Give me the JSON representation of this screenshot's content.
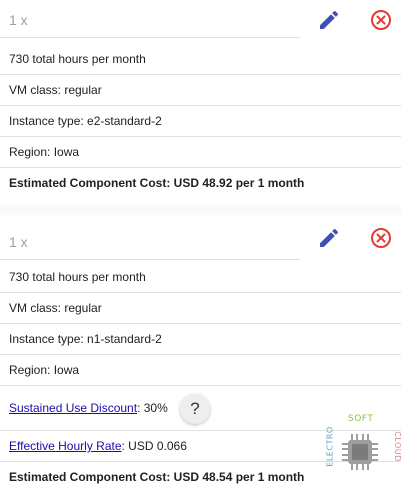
{
  "items": [
    {
      "quantity": "1 x",
      "hours": "730 total hours per month",
      "vm_class": "VM class: regular",
      "instance_type": "Instance type: e2-standard-2",
      "region": "Region: Iowa",
      "estimated_cost": "Estimated Component Cost: USD 48.92 per 1 month"
    },
    {
      "quantity": "1 x",
      "hours": "730 total hours per month",
      "vm_class": "VM class: regular",
      "instance_type": "Instance type: n1-standard-2",
      "region": "Region: Iowa",
      "sustained_use_label": "Sustained Use Discount",
      "sustained_use_value": ": 30%",
      "hourly_rate_label": "Effective Hourly Rate",
      "hourly_rate_value": ": USD 0.066",
      "estimated_cost": "Estimated Component Cost: USD 48.54 per 1 month"
    }
  ],
  "help_button": {
    "label": "?"
  },
  "watermark": {
    "top_text": "SOFT",
    "left_text": "ELECTRO",
    "right_text": "CLOUD"
  },
  "icons": {
    "edit": "pencil-icon",
    "remove": "close-circle-icon"
  },
  "colors": {
    "edit_icon": "#3f51b5",
    "remove_icon": "#e53935",
    "link": "#1a0dab"
  }
}
